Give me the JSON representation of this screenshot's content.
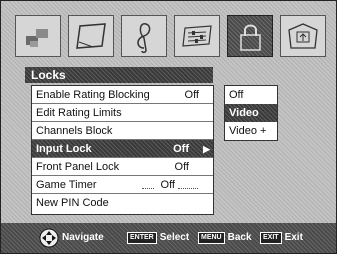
{
  "menu_title": "Locks",
  "tabs": [
    {
      "name": "picture-tab",
      "icon": "picture-icon"
    },
    {
      "name": "screen-tab",
      "icon": "screen-icon"
    },
    {
      "name": "audio-tab",
      "icon": "music-note-icon"
    },
    {
      "name": "setup-tab",
      "icon": "sliders-icon"
    },
    {
      "name": "locks-tab",
      "icon": "padlock-icon",
      "active": true
    },
    {
      "name": "application-tab",
      "icon": "application-icon"
    }
  ],
  "items": [
    {
      "label": "Enable Rating Blocking",
      "value": "Off"
    },
    {
      "label": "Edit Rating Limits",
      "value": ""
    },
    {
      "label": "Channels Block",
      "value": ""
    },
    {
      "label": "Input Lock",
      "value": "Off",
      "selected": true
    },
    {
      "label": "Front Panel Lock",
      "value": "Off"
    },
    {
      "label": "Game Timer",
      "value": "Off"
    },
    {
      "label": "New PIN Code",
      "value": ""
    }
  ],
  "submenu": {
    "options": [
      "Off",
      "Video",
      "Video +"
    ],
    "selected_index": 1
  },
  "navbar": {
    "navigate": "Navigate",
    "enter_key": "ENTER",
    "select": "Select",
    "menu_key": "MENU",
    "back": "Back",
    "exit_key": "EXIT",
    "exit": "Exit"
  }
}
